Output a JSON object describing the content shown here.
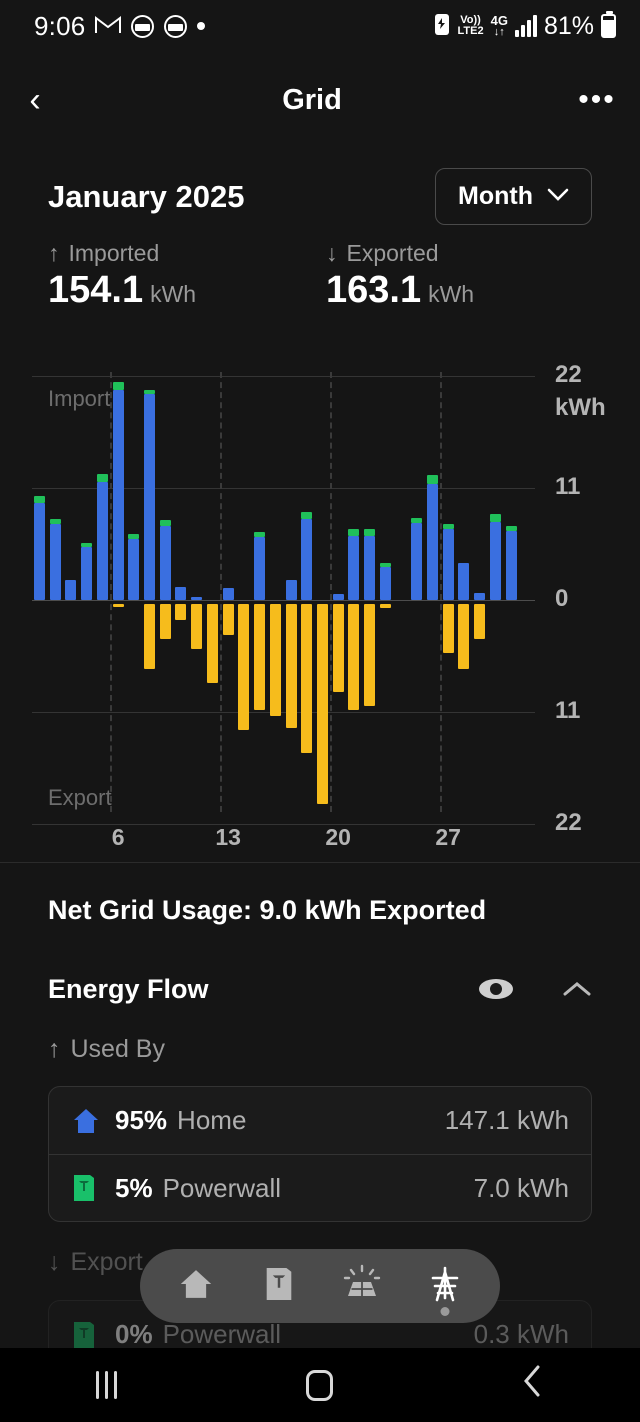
{
  "statusbar": {
    "time": "9:06",
    "icons": [
      "gmail-icon",
      "nbl-icon",
      "nbl-icon",
      "dot-icon"
    ],
    "volte": "Vo))",
    "network_type": "LTE2",
    "generation": "4G",
    "battery_percent": "81%"
  },
  "header": {
    "back_label": "‹",
    "title": "Grid",
    "more_label": "•••"
  },
  "date_row": {
    "period": "January 2025",
    "range_label": "Month",
    "range_chevron": "⌄"
  },
  "totals": [
    {
      "arrow": "↑",
      "label": "Imported",
      "value": "154.1",
      "unit": "kWh"
    },
    {
      "arrow": "↓",
      "label": "Exported",
      "value": "163.1",
      "unit": "kWh"
    }
  ],
  "chart_data": {
    "type": "bar",
    "title": "",
    "xlabel": "",
    "ylabel": "kWh",
    "unit_label": "kWh",
    "import_label": "Import",
    "export_label": "Export",
    "ylim": [
      -22,
      22
    ],
    "ytick_labels": [
      "22",
      "11",
      "0",
      "11",
      "22"
    ],
    "xtick_labels": [
      "6",
      "13",
      "20",
      "27"
    ],
    "xticks": [
      6,
      13,
      20,
      27
    ],
    "grid": true,
    "legend": "none",
    "categories": [
      1,
      2,
      3,
      4,
      5,
      6,
      7,
      8,
      9,
      10,
      11,
      12,
      13,
      14,
      15,
      16,
      17,
      18,
      19,
      20,
      21,
      22,
      23,
      24,
      25,
      26,
      27,
      28,
      29,
      30,
      31
    ],
    "series": [
      {
        "name": "Imported",
        "color": "#3a6fe0",
        "values": [
          9.5,
          7.5,
          2.0,
          5.2,
          11.6,
          20.6,
          6.0,
          20.2,
          7.3,
          1.3,
          0.3,
          0.0,
          1.2,
          0.0,
          6.2,
          0.0,
          2.0,
          8.0,
          0.0,
          0.6,
          6.3,
          6.3,
          3.2,
          0.0,
          7.6,
          11.4,
          7.0,
          3.6,
          0.7,
          7.7,
          6.8
        ]
      },
      {
        "name": "Exported",
        "color": "#f6bc1c",
        "values": [
          0.0,
          0.0,
          0.0,
          0.0,
          0.0,
          0.3,
          0.0,
          6.4,
          3.4,
          1.6,
          4.4,
          7.8,
          3.0,
          12.4,
          10.4,
          11.0,
          12.2,
          14.6,
          19.6,
          8.6,
          10.4,
          10.0,
          0.4,
          0.0,
          0.0,
          0.0,
          4.8,
          6.4,
          3.4,
          0.0,
          0.0
        ]
      },
      {
        "name": "Powerwall charge",
        "color": "#20c05a",
        "values": [
          0.7,
          0.5,
          0.0,
          0.4,
          0.8,
          0.8,
          0.5,
          0.4,
          0.6,
          0.0,
          0.0,
          0.0,
          0.0,
          0.0,
          0.5,
          0.0,
          0.0,
          0.6,
          0.0,
          0.0,
          0.7,
          0.7,
          0.4,
          0.0,
          0.5,
          0.9,
          0.5,
          0.0,
          0.0,
          0.7,
          0.5
        ]
      }
    ]
  },
  "net_usage": "Net Grid Usage: 9.0 kWh Exported",
  "energy_flow": {
    "title": "Energy Flow",
    "eye_icon": "eye-icon",
    "collapse_icon": "chevron-up-icon"
  },
  "used_by": {
    "arrow": "↑",
    "label": "Used By",
    "rows": [
      {
        "icon": "home-icon",
        "percent": "95%",
        "name": "Home",
        "amount": "147.1 kWh"
      },
      {
        "icon": "powerwall-icon",
        "percent": "5%",
        "name": "Powerwall",
        "amount": "7.0 kWh"
      }
    ]
  },
  "exported_to": {
    "arrow": "↓",
    "label": "Export",
    "rows": [
      {
        "icon": "powerwall-icon",
        "percent": "0%",
        "name": "Powerwall",
        "amount": "0.3 kWh"
      }
    ]
  },
  "nav_pill": {
    "items": [
      {
        "icon": "home-icon",
        "active": false
      },
      {
        "icon": "powerwall-icon",
        "active": false
      },
      {
        "icon": "solar-icon",
        "active": false
      },
      {
        "icon": "grid-tower-icon",
        "active": true
      }
    ]
  },
  "system_nav": {
    "recents": "recents-icon",
    "home": "home-square-icon",
    "back": "back-chevron-icon"
  }
}
